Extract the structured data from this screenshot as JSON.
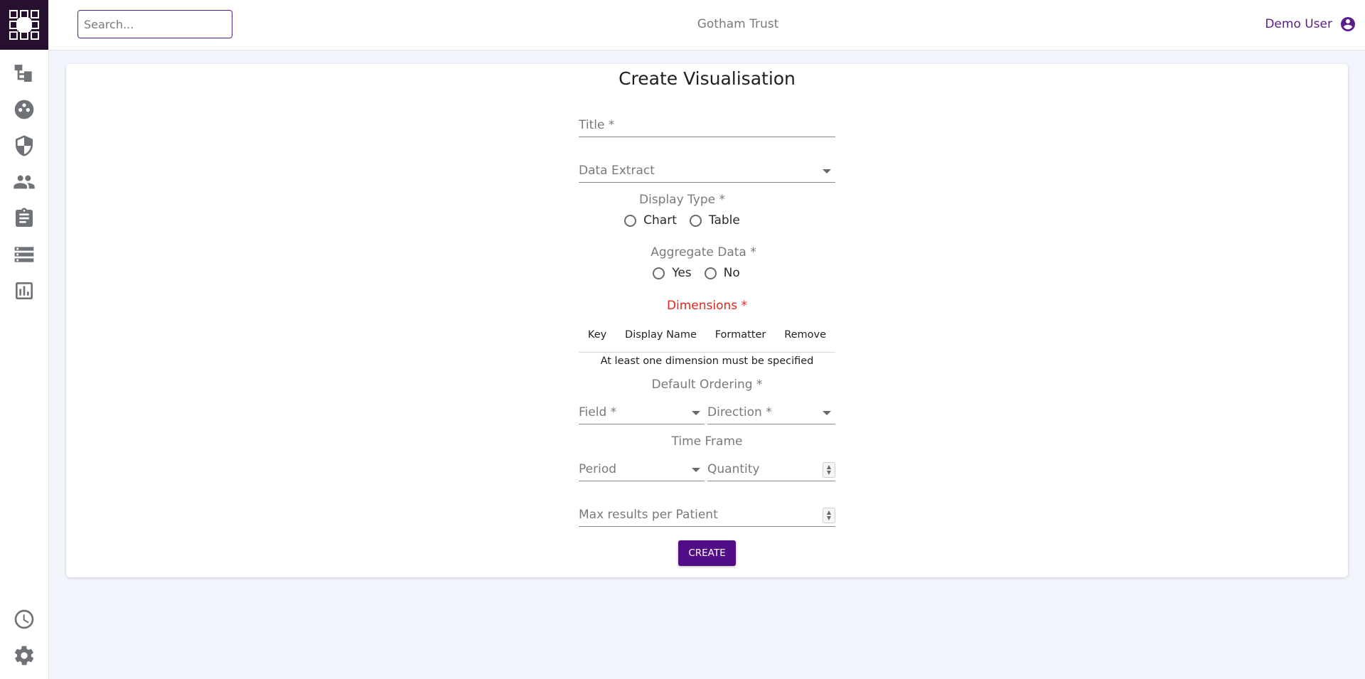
{
  "app": {
    "org_name": "Gotham Trust",
    "user_name": "Demo User",
    "brand_color": "#520e87"
  },
  "search": {
    "placeholder": "Search...",
    "value": ""
  },
  "sidebar": {
    "items": [
      {
        "icon": "hierarchy-icon"
      },
      {
        "icon": "groups-icon"
      },
      {
        "icon": "shield-icon"
      },
      {
        "icon": "people-icon"
      },
      {
        "icon": "clipboard-icon"
      },
      {
        "icon": "list-icon"
      },
      {
        "icon": "chart-icon"
      }
    ],
    "bottom_items": [
      {
        "icon": "clock-icon"
      },
      {
        "icon": "gear-icon"
      }
    ]
  },
  "form": {
    "title": "Create Visualisation",
    "title_field_label": "Title *",
    "data_extract_label": "Data Extract",
    "display_type": {
      "label": "Display Type *",
      "options": [
        "Chart",
        "Table"
      ]
    },
    "aggregate": {
      "label": "Aggregate Data *",
      "options": [
        "Yes",
        "No"
      ]
    },
    "dimensions": {
      "label": "Dimensions *",
      "columns": [
        "Key",
        "Display Name",
        "Formatter",
        "Remove"
      ],
      "message": "At least one dimension must be specified"
    },
    "ordering": {
      "label": "Default Ordering *",
      "field_label": "Field *",
      "direction_label": "Direction *"
    },
    "time_frame": {
      "label": "Time Frame",
      "period_label": "Period",
      "quantity_label": "Quantity"
    },
    "max_results_label": "Max results per Patient",
    "create_label": "CREATE"
  }
}
